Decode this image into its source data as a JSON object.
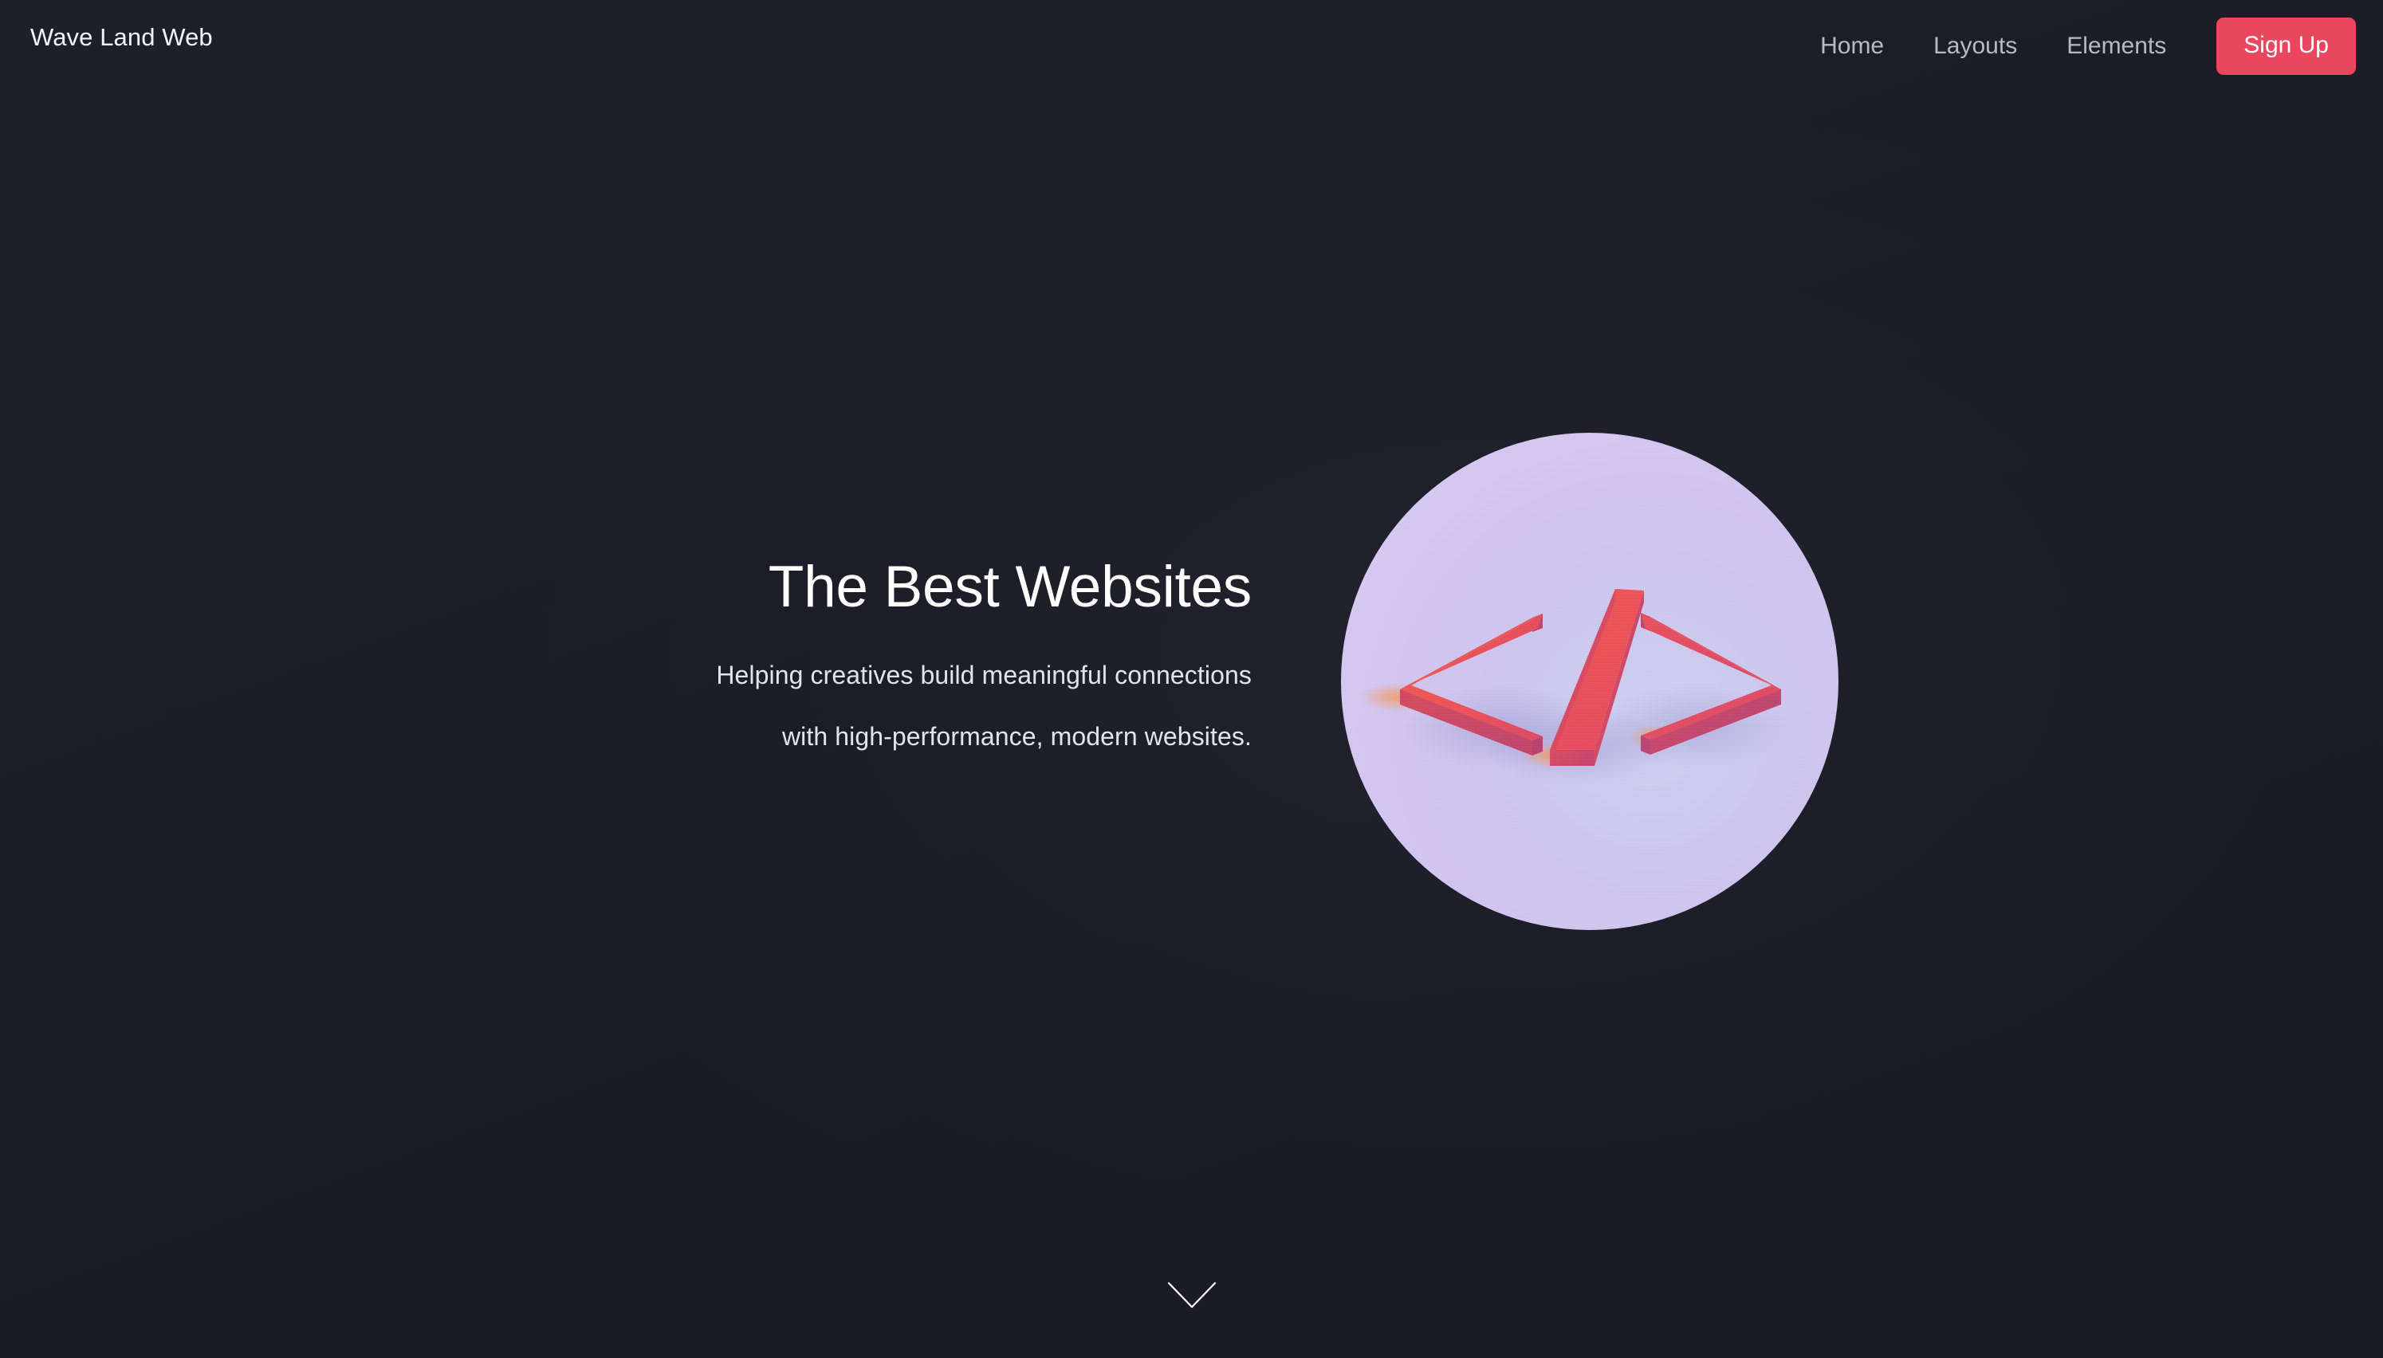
{
  "page": {
    "background_color": "#1b1c26",
    "accent_color": "#e8475f"
  },
  "header": {
    "brand": "Wave Land Web",
    "nav": [
      {
        "label": "Home",
        "name": "nav-link-home"
      },
      {
        "label": "Layouts",
        "name": "nav-link-layouts"
      },
      {
        "label": "Elements",
        "name": "nav-link-elements"
      }
    ],
    "signup_label": "Sign Up"
  },
  "hero": {
    "title": "The Best Websites",
    "subtitle_line1": "Helping creatives build meaningful connections",
    "subtitle_line2": "with high-performance, modern websites.",
    "image": {
      "icon": "code-brackets-3d",
      "alt": "3D code symbol",
      "shape": "circle",
      "background_color": "#d5cbf3",
      "symbol_color": "#ef4d55"
    }
  },
  "footer": {
    "scroll_icon": "chevron-down-icon"
  }
}
